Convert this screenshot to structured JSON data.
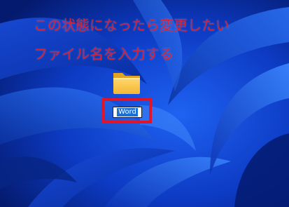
{
  "annotation": {
    "line1": "この状態になったら変更したい",
    "line2": "ファイル名を入力する",
    "color": "#d4213a",
    "highlight_color": "#e0142a"
  },
  "desktop": {
    "wallpaper_color": "#0b2fb0",
    "item": {
      "icon": "folder-icon",
      "name_value": "Word",
      "selection_color": "#1d6fd1"
    }
  }
}
